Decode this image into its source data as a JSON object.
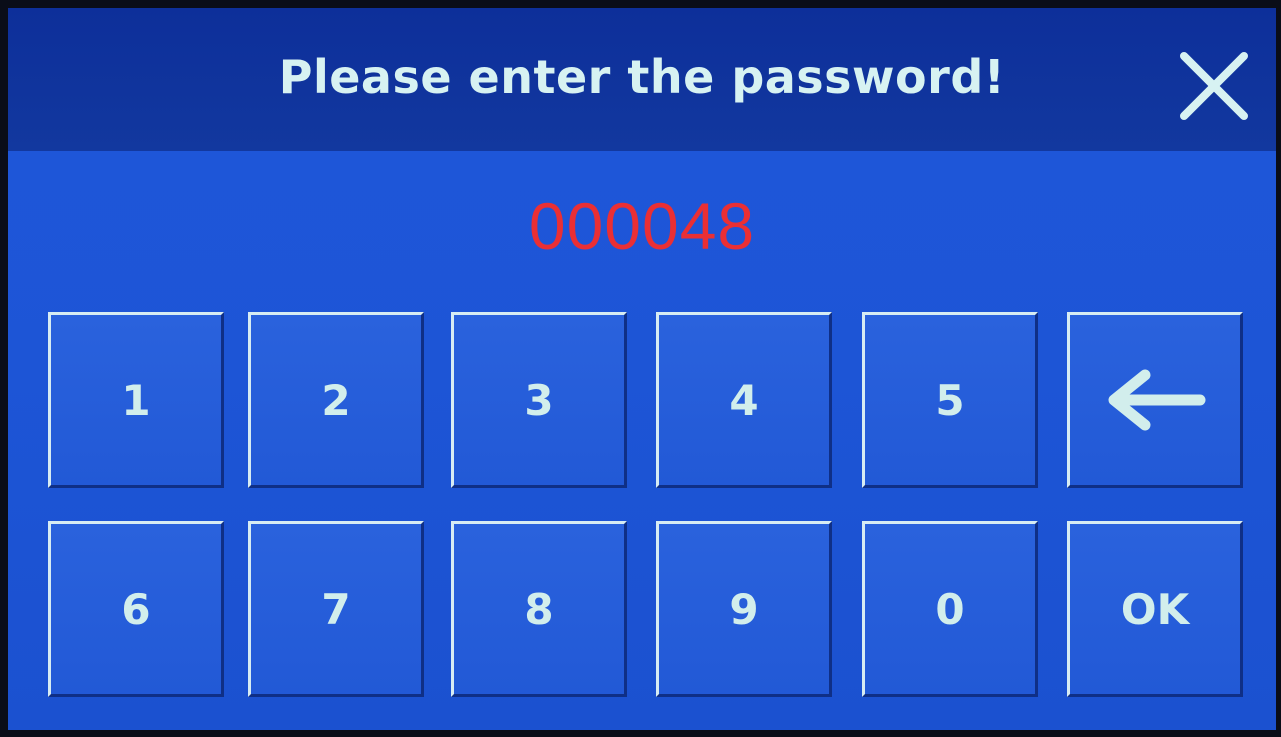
{
  "dialog": {
    "title": "Please enter the password!",
    "close_icon": "close-icon",
    "display_value": "000048",
    "display_color": "#ea2f34",
    "background_color": "#1e55d8",
    "header_color": "#0d2f9a"
  },
  "keypad": {
    "row1": [
      "1",
      "2",
      "3",
      "4",
      "5"
    ],
    "row2": [
      "6",
      "7",
      "8",
      "9",
      "0"
    ],
    "backspace_icon": "backspace-arrow-icon",
    "ok_label": "OK"
  }
}
